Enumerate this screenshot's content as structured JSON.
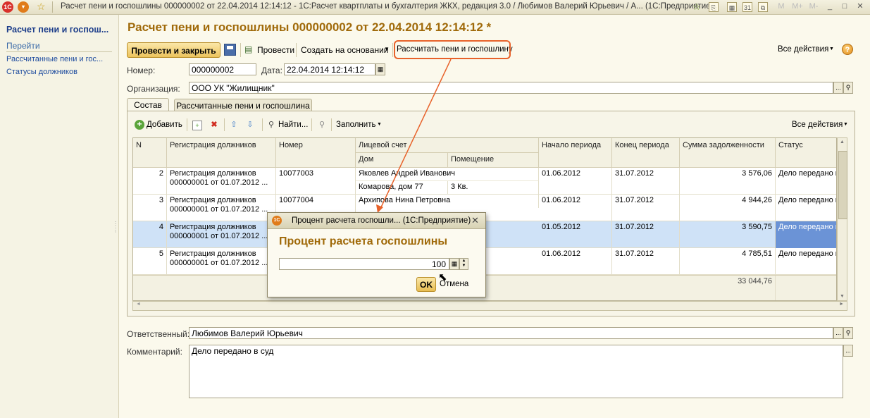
{
  "window": {
    "title": "Расчет пени и госпошлины 000000002 от 22.04.2014 12:14:12 - 1С:Расчет квартплаты и бухгалтерия ЖКХ, редакция 3.0 / Любимов Валерий Юрьевич / А...  (1С:Предприятие)",
    "app_icon": "1С",
    "win_buttons": [
      "M",
      "M+",
      "M-",
      "_",
      "□",
      "✕"
    ]
  },
  "sidebar": {
    "title": "Расчет пени и госпош...",
    "section": "Перейти",
    "links": [
      "Рассчитанные пени и гос...",
      "Статусы должников"
    ]
  },
  "document": {
    "title": "Расчет пени и госпошлины 000000002 от 22.04.2014 12:14:12 *"
  },
  "toolbar": {
    "post_close": "Провести и закрыть",
    "post": "Провести",
    "create_based": "Создать на основании",
    "calculate": "Рассчитать пени и госпошлину",
    "all_actions": "Все действия",
    "help": "?"
  },
  "header_fields": {
    "number_label": "Номер:",
    "number_value": "000000002",
    "date_label": "Дата:",
    "date_value": "22.04.2014 12:14:12",
    "org_label": "Организация:",
    "org_value": "ООО УК \"Жилищник\""
  },
  "tabs": [
    "Состав",
    "Рассчитанные пени и госпошлина"
  ],
  "table_toolbar": {
    "add": "Добавить",
    "find": "Найти...",
    "fill": "Заполнить",
    "all_actions": "Все действия"
  },
  "table": {
    "headers": {
      "n": "N",
      "registration": "Регистрация должников",
      "number": "Номер",
      "account": "Лицевой счет",
      "house": "Дом",
      "premise": "Помещение",
      "start": "Начало периода",
      "end": "Конец периода",
      "sum": "Сумма задолженности",
      "status": "Статус"
    },
    "rows": [
      {
        "n": "2",
        "reg1": "Регистрация должников",
        "reg2": "000000001 от 01.07.2012 ...",
        "number": "10077003",
        "account": "Яковлев Андрей Иванович",
        "house": "Комарова, дом 77",
        "premise": "3 Кв.",
        "start": "01.06.2012",
        "end": "31.07.2012",
        "sum": "3 576,06",
        "status": "Дело передано в"
      },
      {
        "n": "3",
        "reg1": "Регистрация должников",
        "reg2": "000000001 от 01.07.2012 ...",
        "number": "10077004",
        "account": "Архипова Нина Петровна",
        "house": "",
        "premise": "",
        "start": "01.06.2012",
        "end": "31.07.2012",
        "sum": "4 944,26",
        "status": "Дело передано в"
      },
      {
        "n": "4",
        "reg1": "Регистрация должников",
        "reg2": "000000001 от 01.07.2012 ...",
        "number": "",
        "account": "",
        "house": "",
        "premise": "",
        "start": "01.05.2012",
        "end": "31.07.2012",
        "sum": "3 590,75",
        "status": "Дело передано в"
      },
      {
        "n": "5",
        "reg1": "Регистрация должников",
        "reg2": "000000001 от 01.07.2012 ...",
        "number": "",
        "account": "",
        "house": "",
        "premise": "",
        "start": "01.06.2012",
        "end": "31.07.2012",
        "sum": "4 785,51",
        "status": "Дело передано в"
      }
    ],
    "total": "33 044,76"
  },
  "footer_fields": {
    "responsible_label": "Ответственный:",
    "responsible_value": "Любимов Валерий Юрьевич",
    "comment_label": "Комментарий:",
    "comment_value": "Дело передано в суд"
  },
  "dialog": {
    "title": "Процент расчета госпошли...  (1С:Предприятие)",
    "heading": "Процент расчета госпошлины",
    "value": "100",
    "ok": "OK",
    "cancel": "Отмена"
  },
  "colors": {
    "highlight": "#e8622a",
    "selected_row": "#cfe2f7",
    "selected_cell": "#6b93d6"
  }
}
